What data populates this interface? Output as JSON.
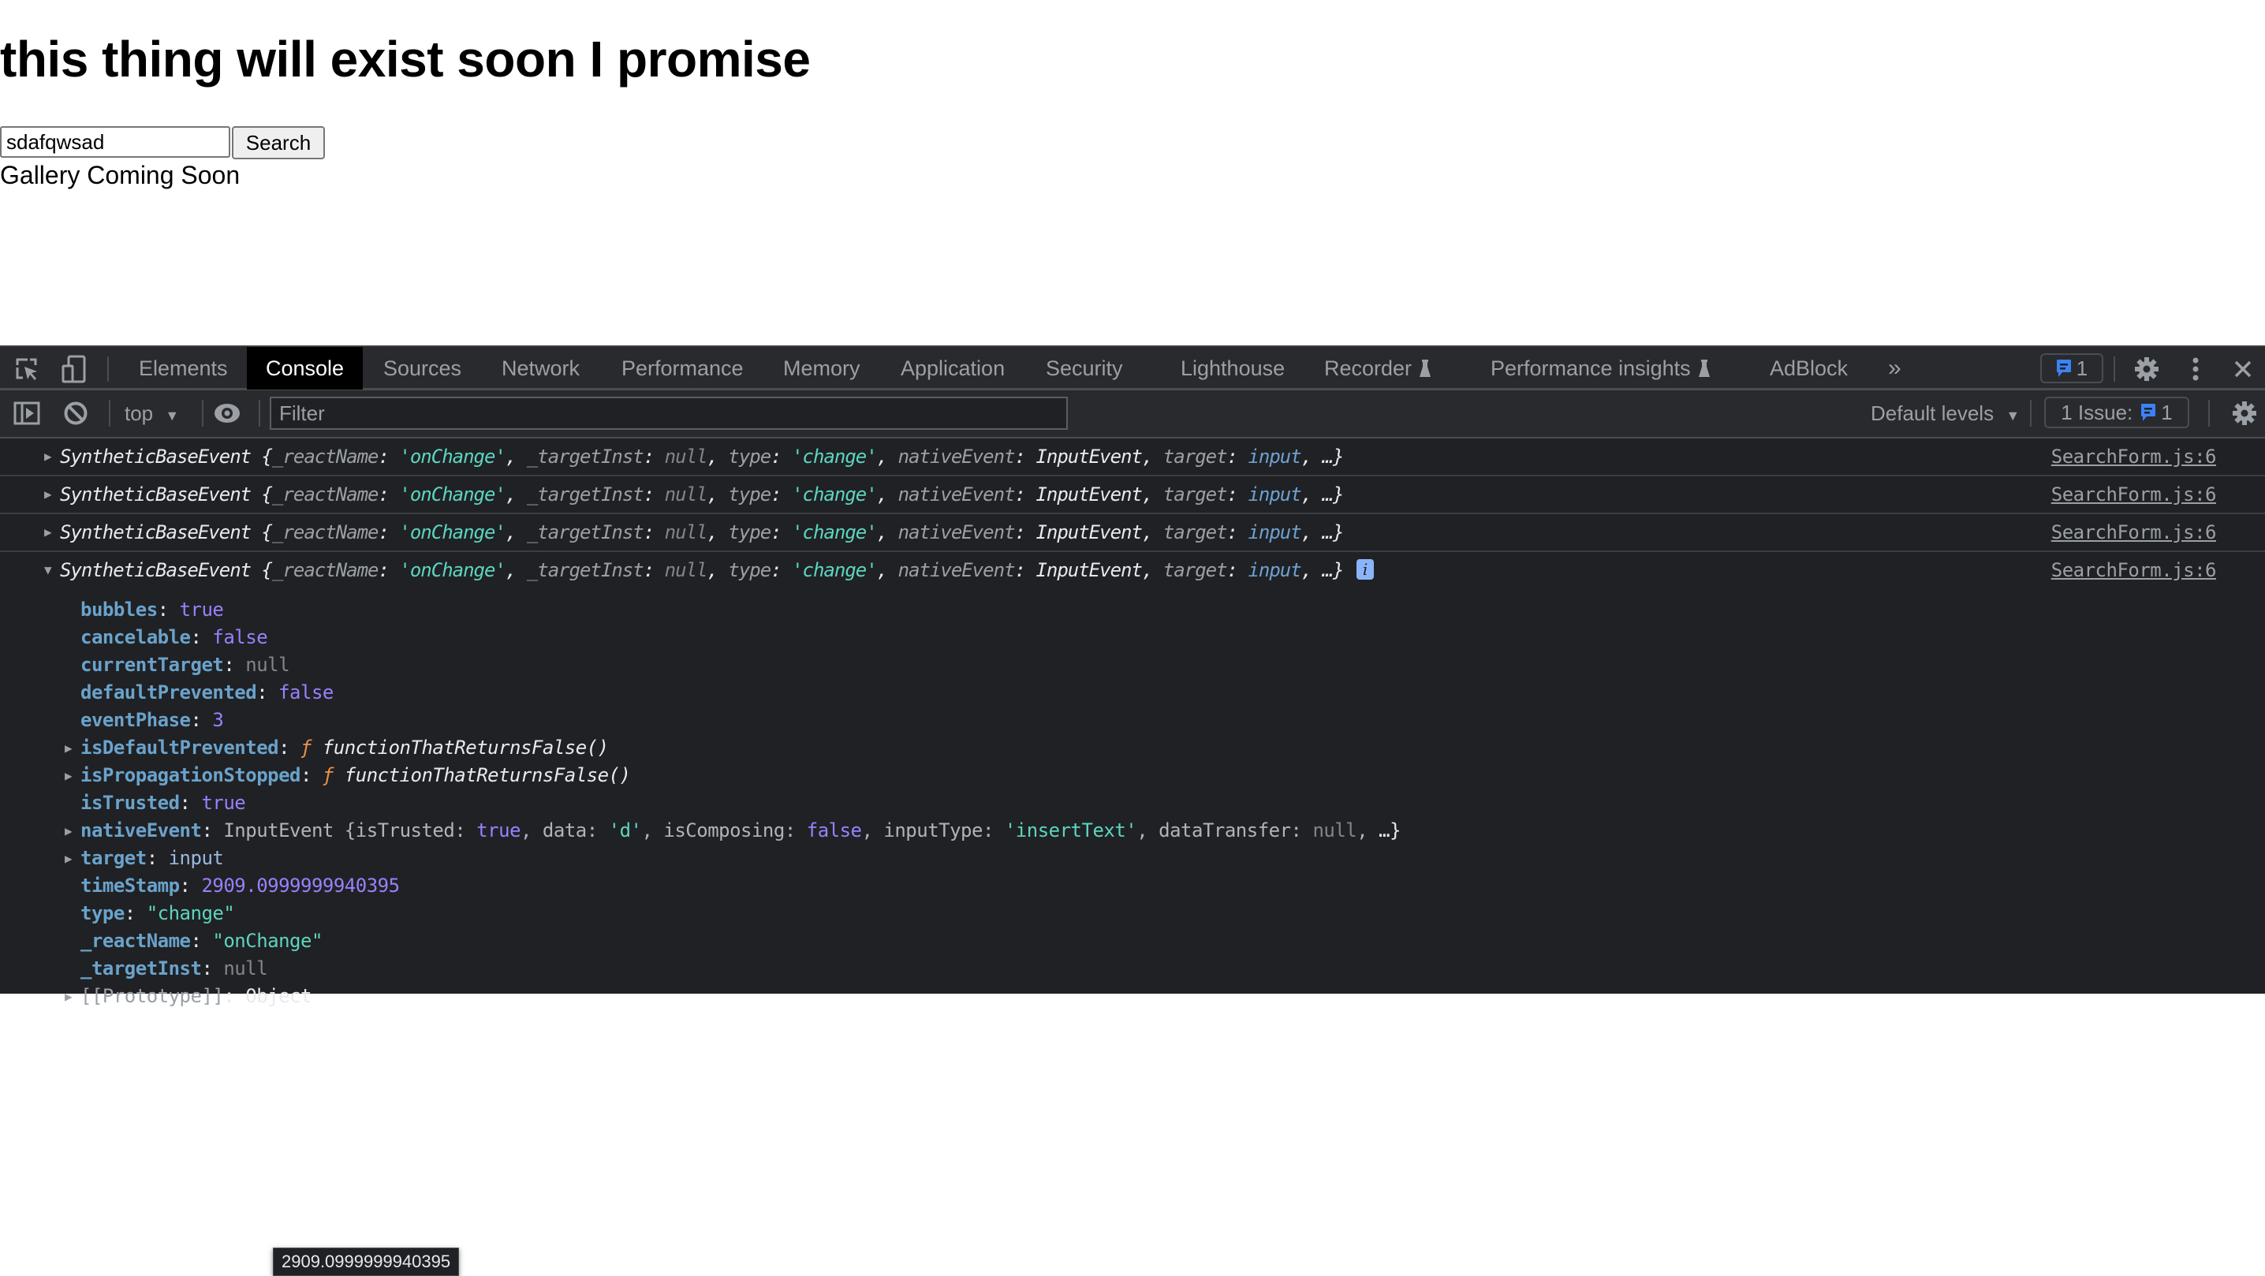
{
  "page": {
    "heading": "this thing will exist soon I promise",
    "search_input_value": "sdafqwsad",
    "search_button": "Search",
    "gallery_text": "Gallery Coming Soon"
  },
  "devtools": {
    "tabs": [
      {
        "label": "Elements",
        "active": false
      },
      {
        "label": "Console",
        "active": true
      },
      {
        "label": "Sources",
        "active": false
      },
      {
        "label": "Network",
        "active": false
      },
      {
        "label": "Performance",
        "active": false
      },
      {
        "label": "Memory",
        "active": false
      },
      {
        "label": "Application",
        "active": false
      },
      {
        "label": "Security",
        "active": false
      },
      {
        "label": "Lighthouse",
        "active": false
      },
      {
        "label": "Recorder",
        "active": false,
        "experimental": true
      },
      {
        "label": "Performance insights",
        "active": false,
        "experimental": true
      },
      {
        "label": "AdBlock",
        "active": false
      }
    ],
    "more_tabs_icon": "»",
    "issues_count": "1",
    "toolbar": {
      "context": "top",
      "filter_placeholder": "Filter",
      "levels": "Default levels",
      "issues_label": "1 Issue:",
      "issues_count": "1"
    },
    "colors": {
      "issue_blue": "#3b82f6",
      "string": "#5cd5c0",
      "boolean": "#9980ff",
      "property": "#6aa3cc",
      "function_f": "#e8924a",
      "background": "#202124"
    }
  },
  "console": {
    "log_rows": [
      {
        "expanded": false,
        "class_name": "SyntheticBaseEvent",
        "source": "SearchForm.js:6"
      },
      {
        "expanded": false,
        "class_name": "SyntheticBaseEvent",
        "source": "SearchForm.js:6"
      },
      {
        "expanded": false,
        "class_name": "SyntheticBaseEvent",
        "source": "SearchForm.js:6"
      },
      {
        "expanded": true,
        "class_name": "SyntheticBaseEvent",
        "source": "SearchForm.js:6"
      }
    ],
    "preview": {
      "open": " {",
      "k1": "_reactName",
      "v1": "'onChange'",
      "k2": "_targetInst",
      "v2": "null",
      "k3": "type",
      "v3": "'change'",
      "k4": "nativeEvent",
      "v4": "InputEvent",
      "k5": "target",
      "v5": "input",
      "close": "…}"
    },
    "properties": [
      {
        "name": "bubbles",
        "value": "true",
        "kind": "bool",
        "expandable": false
      },
      {
        "name": "cancelable",
        "value": "false",
        "kind": "bool",
        "expandable": false
      },
      {
        "name": "currentTarget",
        "value": "null",
        "kind": "null",
        "expandable": false
      },
      {
        "name": "defaultPrevented",
        "value": "false",
        "kind": "bool",
        "expandable": false
      },
      {
        "name": "eventPhase",
        "value": "3",
        "kind": "num",
        "expandable": false
      },
      {
        "name": "isDefaultPrevented",
        "value": "functionThatReturnsFalse()",
        "kind": "fn",
        "expandable": true
      },
      {
        "name": "isPropagationStopped",
        "value": "functionThatReturnsFalse()",
        "kind": "fn",
        "expandable": true
      },
      {
        "name": "isTrusted",
        "value": "true",
        "kind": "bool",
        "expandable": false
      },
      {
        "name": "nativeEvent",
        "value": "InputEvent",
        "kind": "nativeEvent",
        "expandable": true
      },
      {
        "name": "target",
        "value": "input",
        "kind": "node",
        "expandable": true
      },
      {
        "name": "timeStamp",
        "value": "2909.0999999940395",
        "kind": "num",
        "expandable": false
      },
      {
        "name": "type",
        "value": "\"change\"",
        "kind": "str",
        "expandable": false
      },
      {
        "name": "_reactName",
        "value": "\"onChange\"",
        "kind": "str",
        "expandable": false
      },
      {
        "name": "_targetInst",
        "value": "null",
        "kind": "null",
        "expandable": false
      },
      {
        "name": "[[Prototype]]",
        "value": "Object",
        "kind": "proto",
        "expandable": true
      }
    ],
    "native_event_preview": {
      "k1": "isTrusted",
      "v1": "true",
      "k2": "data",
      "v2": "'d'",
      "k3": "isComposing",
      "v3": "false",
      "k4": "inputType",
      "v4": "'insertText'",
      "k5": "dataTransfer",
      "v5": "null",
      "close": "…}"
    },
    "tooltip": "2909.0999999940395"
  }
}
